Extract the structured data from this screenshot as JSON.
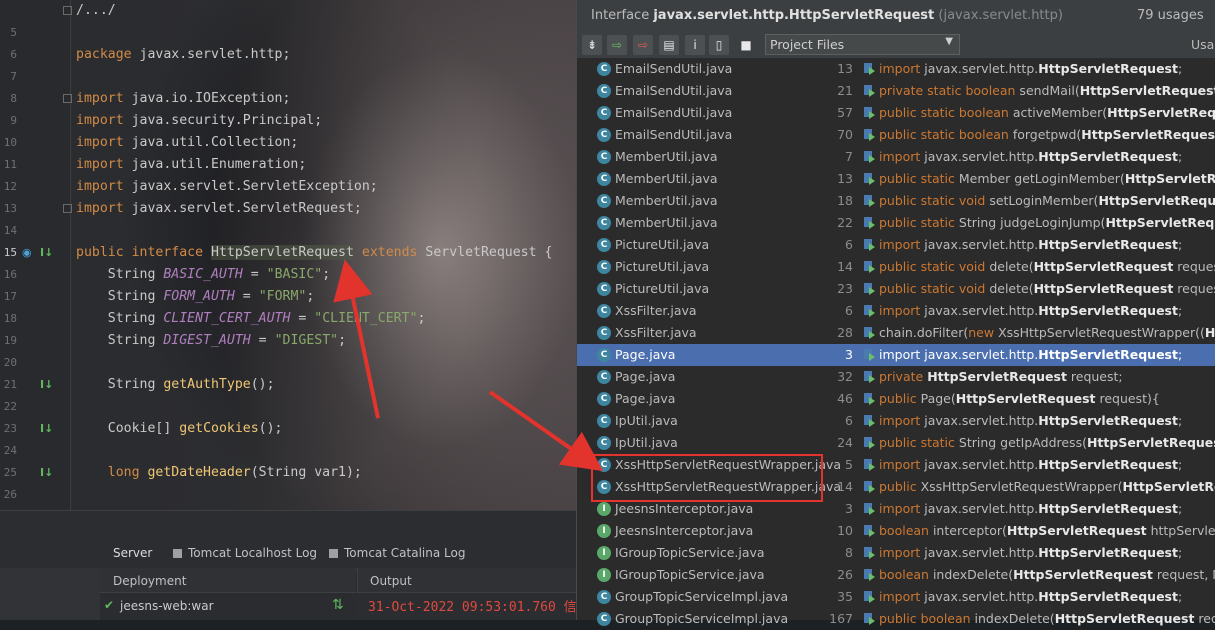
{
  "editor": {
    "lines": [
      {
        "n": "",
        "html": "<span class='pl'>/.../</span>",
        "fold": true
      },
      {
        "n": "5",
        "html": ""
      },
      {
        "n": "6",
        "html": "<span class='kw'>package</span> <span class='pl'>javax.servlet.http;</span>"
      },
      {
        "n": "7",
        "html": ""
      },
      {
        "n": "8",
        "html": "<span class='kw'>import</span> <span class='pl'>java.io.IOException;</span>",
        "fold": true
      },
      {
        "n": "9",
        "html": "<span class='kw'>import</span> <span class='pl'>java.security.Principal;</span>"
      },
      {
        "n": "10",
        "html": "<span class='kw'>import</span> <span class='pl'>java.util.Collection;</span>"
      },
      {
        "n": "11",
        "html": "<span class='kw'>import</span> <span class='pl'>java.util.Enumeration;</span>"
      },
      {
        "n": "12",
        "html": "<span class='kw'>import</span> <span class='pl'>javax.servlet.ServletException;</span>"
      },
      {
        "n": "13",
        "html": "<span class='kw'>import</span> <span class='pl'>javax.servlet.ServletRequest;</span>",
        "fold": true
      },
      {
        "n": "14",
        "html": ""
      },
      {
        "n": "15",
        "html": "<span class='kw'>public interface</span> <span class='hl pl'>HttpServletRequest</span> <span class='kw'>extends</span> <span class='pl'>ServletRequest {</span>",
        "current": true,
        "icons": [
          "blue-ring",
          "down"
        ]
      },
      {
        "n": "16",
        "html": "    <span class='pl'>String</span> <span class='fl'>BASIC_AUTH</span> <span class='pl'>=</span> <span class='st'>\"BASIC\"</span><span class='pl'>;</span>"
      },
      {
        "n": "17",
        "html": "    <span class='pl'>String</span> <span class='fl'>FORM_AUTH</span> <span class='pl'>=</span> <span class='st'>\"FORM\"</span><span class='pl'>;</span>"
      },
      {
        "n": "18",
        "html": "    <span class='pl'>String</span> <span class='fl'>CLIENT_CERT_AUTH</span> <span class='pl'>=</span> <span class='st'>\"CLIENT_CERT\"</span><span class='pl'>;</span>"
      },
      {
        "n": "19",
        "html": "    <span class='pl'>String</span> <span class='fl'>DIGEST_AUTH</span> <span class='pl'>=</span> <span class='st'>\"DIGEST\"</span><span class='pl'>;</span>"
      },
      {
        "n": "20",
        "html": ""
      },
      {
        "n": "21",
        "html": "    <span class='pl'>String</span> <span class='fn'>getAuthType</span><span class='pl'>();</span>",
        "icons": [
          "down"
        ]
      },
      {
        "n": "22",
        "html": ""
      },
      {
        "n": "23",
        "html": "    <span class='pl'>Cookie[]</span> <span class='fn'>getCookies</span><span class='pl'>();</span>",
        "icons": [
          "down"
        ]
      },
      {
        "n": "24",
        "html": ""
      },
      {
        "n": "25",
        "html": "    <span class='kw'>long</span> <span class='fn'>getDateHeader</span><span class='pl'>(String var1);</span>",
        "icons": [
          "down"
        ]
      },
      {
        "n": "26",
        "html": ""
      }
    ]
  },
  "run_panel": {
    "tabs": [
      {
        "label": "Server",
        "active": true
      },
      {
        "label": "Tomcat Localhost Log",
        "active": false
      },
      {
        "label": "Tomcat Catalina Log",
        "active": false
      }
    ],
    "deployment_header": "Deployment",
    "output_header": "Output",
    "deployment_item": "jeesns-web:war",
    "output_line": "31-Oct-2022 09:53:01.760 信"
  },
  "usages": {
    "title_prefix": "Interface",
    "title_class": "javax.servlet.http.HttpServletRequest",
    "title_package": "(javax.servlet.http)",
    "count": "79 usages",
    "scope": "Project Files",
    "usages_label": "Usages",
    "rows": [
      {
        "icon": "C",
        "file": "EmailSendUtil.java",
        "line": "13",
        "code": "<span class='k'>import</span> javax.servlet.http.<span class='b'>HttpServletRequest</span>;"
      },
      {
        "icon": "C",
        "file": "EmailSendUtil.java",
        "line": "21",
        "code": "<span class='k'>private static boolean</span> sendMail(<span class='b'>HttpServletRequest</span> request"
      },
      {
        "icon": "C",
        "file": "EmailSendUtil.java",
        "line": "57",
        "code": "<span class='k'>public static boolean</span> activeMember(<span class='b'>HttpServletRequest</span> req"
      },
      {
        "icon": "C",
        "file": "EmailSendUtil.java",
        "line": "70",
        "code": "<span class='k'>public static boolean</span> forgetpwd(<span class='b'>HttpServletRequest</span> requ"
      },
      {
        "icon": "C",
        "file": "MemberUtil.java",
        "line": "7",
        "code": "<span class='k'>import</span> javax.servlet.http.<span class='b'>HttpServletRequest</span>;"
      },
      {
        "icon": "C",
        "file": "MemberUtil.java",
        "line": "13",
        "code": "<span class='k'>public static</span> Member getLoginMember(<span class='b'>HttpServletReque</span>"
      },
      {
        "icon": "C",
        "file": "MemberUtil.java",
        "line": "18",
        "code": "<span class='k'>public static void</span> setLoginMember(<span class='b'>HttpServletRequest</span> re"
      },
      {
        "icon": "C",
        "file": "MemberUtil.java",
        "line": "22",
        "code": "<span class='k'>public static</span> String judgeLoginJump(<span class='b'>HttpServletRequest</span>"
      },
      {
        "icon": "C",
        "file": "PictureUtil.java",
        "line": "6",
        "code": "<span class='k'>import</span> javax.servlet.http.<span class='b'>HttpServletRequest</span>;"
      },
      {
        "icon": "C",
        "file": "PictureUtil.java",
        "line": "14",
        "code": "<span class='k'>public static void</span> delete(<span class='b'>HttpServletRequest</span> request, List"
      },
      {
        "icon": "C",
        "file": "PictureUtil.java",
        "line": "23",
        "code": "<span class='k'>public static void</span> delete(<span class='b'>HttpServletRequest</span> request, Pict"
      },
      {
        "icon": "C",
        "file": "XssFilter.java",
        "line": "6",
        "code": "<span class='k'>import</span> javax.servlet.http.<span class='b'>HttpServletRequest</span>;"
      },
      {
        "icon": "C",
        "file": "XssFilter.java",
        "line": "28",
        "code": "chain.doFilter(<span class='k'>new</span> XssHttpServletRequestWrapper((<span class='b'>HttpSe</span>"
      },
      {
        "icon": "C",
        "file": "Page.java",
        "line": "3",
        "code": "<span class='k'>import</span> javax.servlet.http.<span class='b'>HttpServletRequest</span>;",
        "selected": true
      },
      {
        "icon": "C",
        "file": "Page.java",
        "line": "32",
        "code": "<span class='k'>private</span> <span class='b'>HttpServletRequest</span> request;"
      },
      {
        "icon": "C",
        "file": "Page.java",
        "line": "46",
        "code": "<span class='k'>public</span> Page(<span class='b'>HttpServletRequest</span> request){"
      },
      {
        "icon": "C",
        "file": "IpUtil.java",
        "line": "6",
        "code": "<span class='k'>import</span> javax.servlet.http.<span class='b'>HttpServletRequest</span>;"
      },
      {
        "icon": "C",
        "file": "IpUtil.java",
        "line": "24",
        "code": "<span class='k'>public static</span> String getIpAddress(<span class='b'>HttpServletRequest</span> req"
      },
      {
        "icon": "C",
        "file": "XssHttpServletRequestWrapper.java",
        "line": "5",
        "code": "<span class='k'>import</span> javax.servlet.http.<span class='b'>HttpServletRequest</span>;"
      },
      {
        "icon": "C",
        "file": "XssHttpServletRequestWrapper.java",
        "line": "14",
        "code": "<span class='k'>public</span> XssHttpServletRequestWrapper(<span class='b'>HttpServletReques</span>"
      },
      {
        "icon": "I",
        "file": "JeesnsInterceptor.java",
        "line": "3",
        "code": "<span class='k'>import</span> javax.servlet.http.<span class='b'>HttpServletRequest</span>;"
      },
      {
        "icon": "I",
        "file": "JeesnsInterceptor.java",
        "line": "10",
        "code": "<span class='k'>boolean</span> interceptor(<span class='b'>HttpServletRequest</span> httpServletReque"
      },
      {
        "icon": "I",
        "file": "IGroupTopicService.java",
        "line": "8",
        "code": "<span class='k'>import</span> javax.servlet.http.<span class='b'>HttpServletRequest</span>;"
      },
      {
        "icon": "I",
        "file": "IGroupTopicService.java",
        "line": "26",
        "code": "<span class='k'>boolean</span> indexDelete(<span class='b'>HttpServletRequest</span> request, Memb"
      },
      {
        "icon": "C",
        "file": "GroupTopicServiceImpl.java",
        "line": "35",
        "code": "<span class='k'>import</span> javax.servlet.http.<span class='b'>HttpServletRequest</span>;"
      },
      {
        "icon": "C",
        "file": "GroupTopicServiceImpl.java",
        "line": "167",
        "code": "<span class='k'>public boolean</span> indexDelete(<span class='b'>HttpServletRequest</span> request"
      }
    ]
  },
  "colors": {
    "selection": "#4b6eaf",
    "annotation_red": "#e2342d",
    "keyword": "#cc7832"
  }
}
